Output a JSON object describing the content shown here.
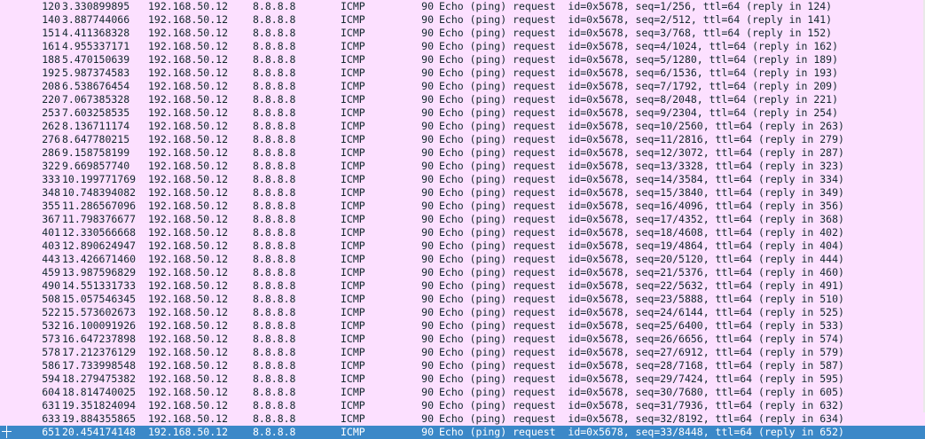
{
  "packet_list": {
    "row_color": "#fce0ff",
    "selected_color": "#3b88c8",
    "selected_index": 32,
    "rows": [
      {
        "no": "120",
        "time": "3.330899895",
        "src": "192.168.50.12",
        "dst": "8.8.8.8",
        "proto": "ICMP",
        "len": "90",
        "info": "Echo (ping) request  id=0x5678, seq=1/256, ttl=64 (reply in 124)"
      },
      {
        "no": "140",
        "time": "3.887744066",
        "src": "192.168.50.12",
        "dst": "8.8.8.8",
        "proto": "ICMP",
        "len": "90",
        "info": "Echo (ping) request  id=0x5678, seq=2/512, ttl=64 (reply in 141)"
      },
      {
        "no": "151",
        "time": "4.411368328",
        "src": "192.168.50.12",
        "dst": "8.8.8.8",
        "proto": "ICMP",
        "len": "90",
        "info": "Echo (ping) request  id=0x5678, seq=3/768, ttl=64 (reply in 152)"
      },
      {
        "no": "161",
        "time": "4.955337171",
        "src": "192.168.50.12",
        "dst": "8.8.8.8",
        "proto": "ICMP",
        "len": "90",
        "info": "Echo (ping) request  id=0x5678, seq=4/1024, ttl=64 (reply in 162)"
      },
      {
        "no": "188",
        "time": "5.470150639",
        "src": "192.168.50.12",
        "dst": "8.8.8.8",
        "proto": "ICMP",
        "len": "90",
        "info": "Echo (ping) request  id=0x5678, seq=5/1280, ttl=64 (reply in 189)"
      },
      {
        "no": "192",
        "time": "5.987374583",
        "src": "192.168.50.12",
        "dst": "8.8.8.8",
        "proto": "ICMP",
        "len": "90",
        "info": "Echo (ping) request  id=0x5678, seq=6/1536, ttl=64 (reply in 193)"
      },
      {
        "no": "208",
        "time": "6.538676454",
        "src": "192.168.50.12",
        "dst": "8.8.8.8",
        "proto": "ICMP",
        "len": "90",
        "info": "Echo (ping) request  id=0x5678, seq=7/1792, ttl=64 (reply in 209)"
      },
      {
        "no": "220",
        "time": "7.067385328",
        "src": "192.168.50.12",
        "dst": "8.8.8.8",
        "proto": "ICMP",
        "len": "90",
        "info": "Echo (ping) request  id=0x5678, seq=8/2048, ttl=64 (reply in 221)"
      },
      {
        "no": "253",
        "time": "7.603258535",
        "src": "192.168.50.12",
        "dst": "8.8.8.8",
        "proto": "ICMP",
        "len": "90",
        "info": "Echo (ping) request  id=0x5678, seq=9/2304, ttl=64 (reply in 254)"
      },
      {
        "no": "262",
        "time": "8.136711174",
        "src": "192.168.50.12",
        "dst": "8.8.8.8",
        "proto": "ICMP",
        "len": "90",
        "info": "Echo (ping) request  id=0x5678, seq=10/2560, ttl=64 (reply in 263)"
      },
      {
        "no": "276",
        "time": "8.647780215",
        "src": "192.168.50.12",
        "dst": "8.8.8.8",
        "proto": "ICMP",
        "len": "90",
        "info": "Echo (ping) request  id=0x5678, seq=11/2816, ttl=64 (reply in 279)"
      },
      {
        "no": "286",
        "time": "9.158758199",
        "src": "192.168.50.12",
        "dst": "8.8.8.8",
        "proto": "ICMP",
        "len": "90",
        "info": "Echo (ping) request  id=0x5678, seq=12/3072, ttl=64 (reply in 287)"
      },
      {
        "no": "322",
        "time": "9.669857740",
        "src": "192.168.50.12",
        "dst": "8.8.8.8",
        "proto": "ICMP",
        "len": "90",
        "info": "Echo (ping) request  id=0x5678, seq=13/3328, ttl=64 (reply in 323)"
      },
      {
        "no": "333",
        "time": "10.199771769",
        "src": "192.168.50.12",
        "dst": "8.8.8.8",
        "proto": "ICMP",
        "len": "90",
        "info": "Echo (ping) request  id=0x5678, seq=14/3584, ttl=64 (reply in 334)"
      },
      {
        "no": "348",
        "time": "10.748394082",
        "src": "192.168.50.12",
        "dst": "8.8.8.8",
        "proto": "ICMP",
        "len": "90",
        "info": "Echo (ping) request  id=0x5678, seq=15/3840, ttl=64 (reply in 349)"
      },
      {
        "no": "355",
        "time": "11.286567096",
        "src": "192.168.50.12",
        "dst": "8.8.8.8",
        "proto": "ICMP",
        "len": "90",
        "info": "Echo (ping) request  id=0x5678, seq=16/4096, ttl=64 (reply in 356)"
      },
      {
        "no": "367",
        "time": "11.798376677",
        "src": "192.168.50.12",
        "dst": "8.8.8.8",
        "proto": "ICMP",
        "len": "90",
        "info": "Echo (ping) request  id=0x5678, seq=17/4352, ttl=64 (reply in 368)"
      },
      {
        "no": "401",
        "time": "12.330566668",
        "src": "192.168.50.12",
        "dst": "8.8.8.8",
        "proto": "ICMP",
        "len": "90",
        "info": "Echo (ping) request  id=0x5678, seq=18/4608, ttl=64 (reply in 402)"
      },
      {
        "no": "403",
        "time": "12.890624947",
        "src": "192.168.50.12",
        "dst": "8.8.8.8",
        "proto": "ICMP",
        "len": "90",
        "info": "Echo (ping) request  id=0x5678, seq=19/4864, ttl=64 (reply in 404)"
      },
      {
        "no": "443",
        "time": "13.426671460",
        "src": "192.168.50.12",
        "dst": "8.8.8.8",
        "proto": "ICMP",
        "len": "90",
        "info": "Echo (ping) request  id=0x5678, seq=20/5120, ttl=64 (reply in 444)"
      },
      {
        "no": "459",
        "time": "13.987596829",
        "src": "192.168.50.12",
        "dst": "8.8.8.8",
        "proto": "ICMP",
        "len": "90",
        "info": "Echo (ping) request  id=0x5678, seq=21/5376, ttl=64 (reply in 460)"
      },
      {
        "no": "490",
        "time": "14.551331733",
        "src": "192.168.50.12",
        "dst": "8.8.8.8",
        "proto": "ICMP",
        "len": "90",
        "info": "Echo (ping) request  id=0x5678, seq=22/5632, ttl=64 (reply in 491)"
      },
      {
        "no": "508",
        "time": "15.057546345",
        "src": "192.168.50.12",
        "dst": "8.8.8.8",
        "proto": "ICMP",
        "len": "90",
        "info": "Echo (ping) request  id=0x5678, seq=23/5888, ttl=64 (reply in 510)"
      },
      {
        "no": "522",
        "time": "15.573602673",
        "src": "192.168.50.12",
        "dst": "8.8.8.8",
        "proto": "ICMP",
        "len": "90",
        "info": "Echo (ping) request  id=0x5678, seq=24/6144, ttl=64 (reply in 525)"
      },
      {
        "no": "532",
        "time": "16.100091926",
        "src": "192.168.50.12",
        "dst": "8.8.8.8",
        "proto": "ICMP",
        "len": "90",
        "info": "Echo (ping) request  id=0x5678, seq=25/6400, ttl=64 (reply in 533)"
      },
      {
        "no": "573",
        "time": "16.647237898",
        "src": "192.168.50.12",
        "dst": "8.8.8.8",
        "proto": "ICMP",
        "len": "90",
        "info": "Echo (ping) request  id=0x5678, seq=26/6656, ttl=64 (reply in 574)"
      },
      {
        "no": "578",
        "time": "17.212376129",
        "src": "192.168.50.12",
        "dst": "8.8.8.8",
        "proto": "ICMP",
        "len": "90",
        "info": "Echo (ping) request  id=0x5678, seq=27/6912, ttl=64 (reply in 579)"
      },
      {
        "no": "586",
        "time": "17.733998548",
        "src": "192.168.50.12",
        "dst": "8.8.8.8",
        "proto": "ICMP",
        "len": "90",
        "info": "Echo (ping) request  id=0x5678, seq=28/7168, ttl=64 (reply in 587)"
      },
      {
        "no": "594",
        "time": "18.279475382",
        "src": "192.168.50.12",
        "dst": "8.8.8.8",
        "proto": "ICMP",
        "len": "90",
        "info": "Echo (ping) request  id=0x5678, seq=29/7424, ttl=64 (reply in 595)"
      },
      {
        "no": "604",
        "time": "18.814740025",
        "src": "192.168.50.12",
        "dst": "8.8.8.8",
        "proto": "ICMP",
        "len": "90",
        "info": "Echo (ping) request  id=0x5678, seq=30/7680, ttl=64 (reply in 605)"
      },
      {
        "no": "631",
        "time": "19.351824094",
        "src": "192.168.50.12",
        "dst": "8.8.8.8",
        "proto": "ICMP",
        "len": "90",
        "info": "Echo (ping) request  id=0x5678, seq=31/7936, ttl=64 (reply in 632)"
      },
      {
        "no": "633",
        "time": "19.884355865",
        "src": "192.168.50.12",
        "dst": "8.8.8.8",
        "proto": "ICMP",
        "len": "90",
        "info": "Echo (ping) request  id=0x5678, seq=32/8192, ttl=64 (reply in 634)"
      },
      {
        "no": "651",
        "time": "20.454174148",
        "src": "192.168.50.12",
        "dst": "8.8.8.8",
        "proto": "ICMP",
        "len": "90",
        "info": "Echo (ping) request  id=0x5678, seq=33/8448, ttl=64 (reply in 652)"
      }
    ]
  }
}
